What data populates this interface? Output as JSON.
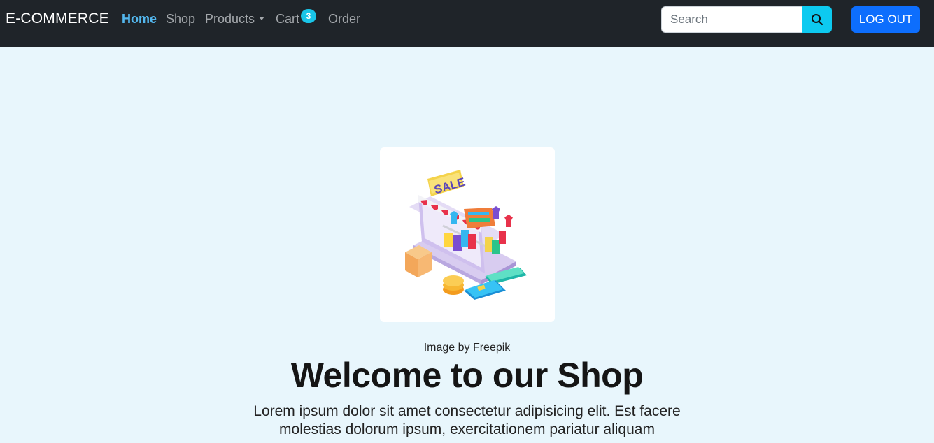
{
  "navbar": {
    "brand": "E-COMMERCE",
    "links": [
      {
        "label": "Home",
        "active": true
      },
      {
        "label": "Shop"
      },
      {
        "label": "Products",
        "dropdown": true
      },
      {
        "label": "Cart"
      },
      {
        "label": "Order"
      }
    ],
    "cart_count": "3",
    "search": {
      "placeholder": "Search",
      "value": ""
    },
    "search_icon": "search-icon",
    "logout_label": "LOG OUT"
  },
  "hero": {
    "sign_text": "SALE",
    "credit": "Image by Freepik",
    "title": "Welcome to our Shop",
    "lead": "Lorem ipsum dolor sit amet consectetur adipisicing elit. Est facere molestias dolorum ipsum, exercitationem pariatur aliquam"
  },
  "colors": {
    "navbar_bg": "#1f2429",
    "page_bg": "#e8f6fc",
    "active_link": "#53b7ee",
    "search_btn": "#0dcaf0",
    "logout_btn": "#0d6efd",
    "badge": "#19c5e8"
  }
}
